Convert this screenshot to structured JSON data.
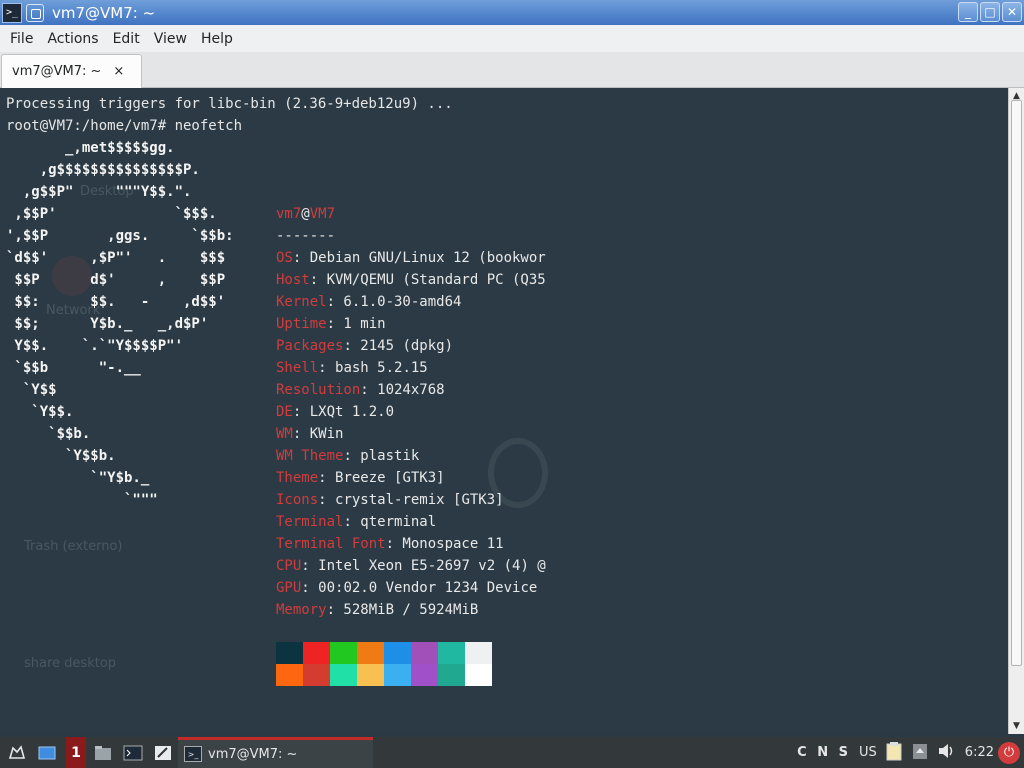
{
  "window": {
    "title": "vm7@VM7: ~",
    "min": "_",
    "max": "□",
    "close": "✕"
  },
  "menu": [
    "File",
    "Actions",
    "Edit",
    "View",
    "Help"
  ],
  "tab": {
    "label": "vm7@VM7: ~",
    "close": "×"
  },
  "terminal": {
    "line1": "Processing triggers for libc-bin (2.36-9+deb12u9) ...",
    "line2": "root@VM7:/home/vm7# neofetch",
    "ascii": "       _,met$$$$$gg.\n    ,g$$$$$$$$$$$$$$$P.\n  ,g$$P\"     \"\"\"Y$$.\".\n ,$$P'              `$$$.\n',$$P       ,ggs.     `$$b:\n`d$$'     ,$P\"'   .    $$$\n $$P      d$'     ,    $$P\n $$:      $$.   -    ,d$$'\n $$;      Y$b._   _,d$P'\n Y$$.    `.`\"Y$$$$P\"'\n `$$b      \"-.__\n  `Y$$\n   `Y$$.\n     `$$b.\n       `Y$$b.\n          `\"Y$b._\n              `\"\"\"",
    "user": "vm7",
    "at": "@",
    "host": "VM7",
    "separator": "-------",
    "info": [
      {
        "key": "OS",
        "value": ": Debian GNU/Linux 12 (bookwor"
      },
      {
        "key": "Host",
        "value": ": KVM/QEMU (Standard PC (Q35"
      },
      {
        "key": "Kernel",
        "value": ": 6.1.0-30-amd64"
      },
      {
        "key": "Uptime",
        "value": ": 1 min"
      },
      {
        "key": "Packages",
        "value": ": 2145 (dpkg)"
      },
      {
        "key": "Shell",
        "value": ": bash 5.2.15"
      },
      {
        "key": "Resolution",
        "value": ": 1024x768"
      },
      {
        "key": "DE",
        "value": ": LXQt 1.2.0"
      },
      {
        "key": "WM",
        "value": ": KWin"
      },
      {
        "key": "WM Theme",
        "value": ": plastik"
      },
      {
        "key": "Theme",
        "value": ": Breeze [GTK3]"
      },
      {
        "key": "Icons",
        "value": ": crystal-remix [GTK3]"
      },
      {
        "key": "Terminal",
        "value": ": qterminal"
      },
      {
        "key": "Terminal Font",
        "value": ": Monospace 11"
      },
      {
        "key": "CPU",
        "value": ": Intel Xeon E5-2697 v2 (4) @"
      },
      {
        "key": "GPU",
        "value": ": 00:02.0 Vendor 1234 Device"
      },
      {
        "key": "Memory",
        "value": ": 528MiB / 5924MiB"
      }
    ],
    "palette": [
      "#0b3340",
      "#ee2424",
      "#20c820",
      "#f07b14",
      "#1e8fe6",
      "#a050b8",
      "#20b8a0",
      "#eef0f2",
      "#ff6610",
      "#d43c30",
      "#20e0a8",
      "#f8c050",
      "#3ab0f0",
      "#a050c8",
      "#20a890",
      "#ffffff"
    ]
  },
  "desktop_ghosts": [
    "Desktop",
    "Network",
    "Trash (externo)",
    "share desktop"
  ],
  "taskbar": {
    "desktop_number": "1",
    "window_label": "vm7@VM7: ~",
    "keyboard_indicators": "C N S",
    "layout": "US",
    "clock": "6:22"
  }
}
